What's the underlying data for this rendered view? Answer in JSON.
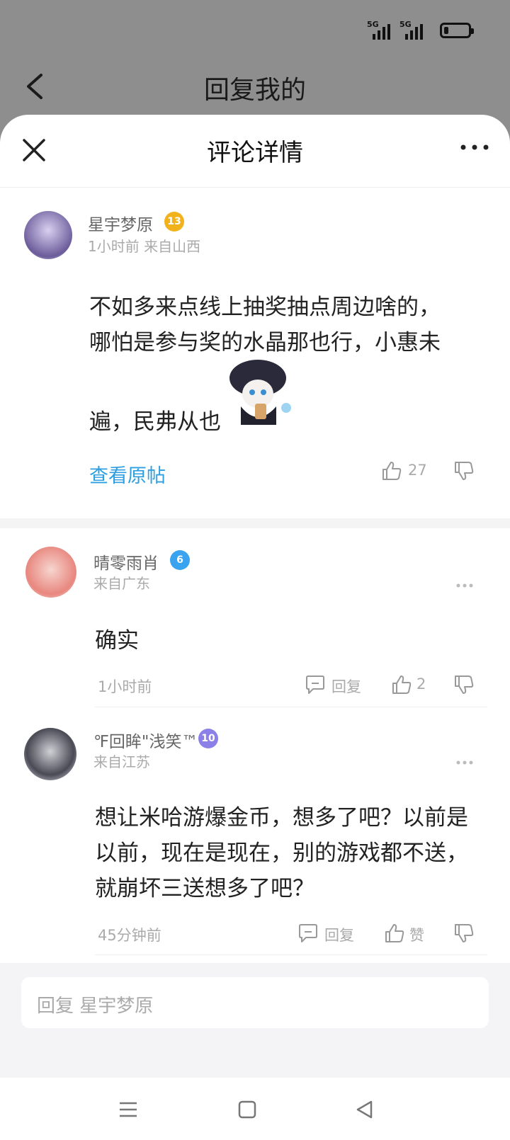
{
  "status": {
    "signal1": "5G",
    "signal2": "5G",
    "battery_level": 0.2
  },
  "behind": {
    "title": "回复我的"
  },
  "sheet": {
    "title": "评论详情"
  },
  "main_comment": {
    "username": "星宇梦原",
    "level": "13",
    "meta": "1小时前 来自山西",
    "lines": [
      "不如多来点线上抽奖抽点周边啥的，",
      "哪怕是参与奖的水晶那也行，小惠未",
      "遍，民弗从也"
    ],
    "view_post": "查看原帖",
    "likes": "27"
  },
  "replies": [
    {
      "username": "晴零雨肖",
      "level": "6",
      "location": "来自广东",
      "lines": [
        "确实"
      ],
      "time": "1小时前",
      "reply_label": "回复",
      "likes": "2"
    },
    {
      "username": "℉回眸\"浅笑™",
      "level": "10",
      "location": "来自江苏",
      "lines": [
        "想让米哈游爆金币，想多了吧？以前是",
        "以前，现在是现在，别的游戏都不送，",
        "就崩坏三送想多了吧？"
      ],
      "time": "45分钟前",
      "reply_label": "回复",
      "likes": "赞"
    }
  ],
  "input": {
    "placeholder": "回复 星宇梦原"
  },
  "colors": {
    "link": "#2d9fe0",
    "level_gold": "#f1b21c",
    "level_blue": "#3aa3ef",
    "level_purple": "#8b7fe8"
  }
}
